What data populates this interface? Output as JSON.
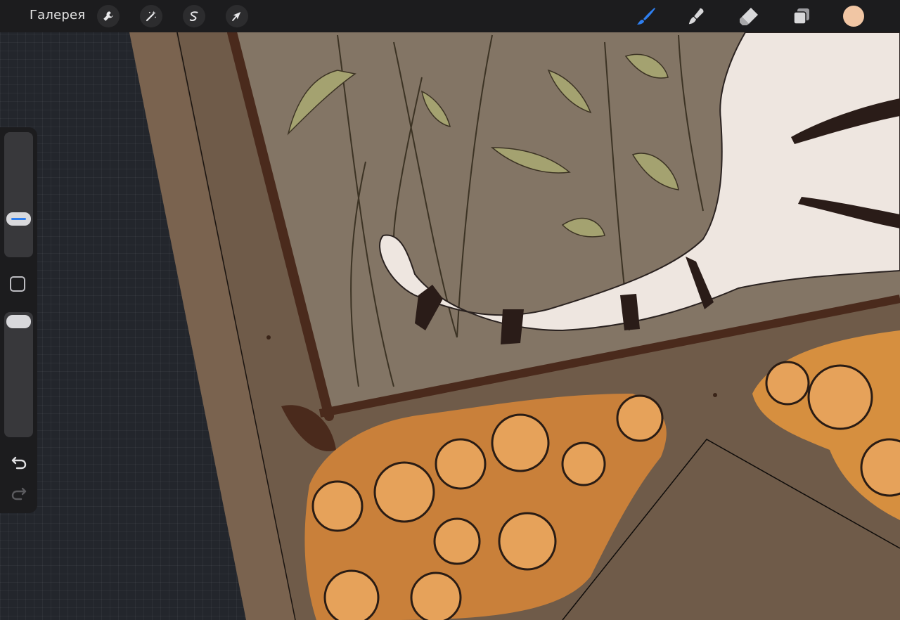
{
  "toolbar": {
    "gallery_label": "Галерея",
    "left_tools": [
      {
        "name": "actions",
        "icon": "wrench-icon"
      },
      {
        "name": "adjustments",
        "icon": "magic-wand-icon"
      },
      {
        "name": "selection",
        "icon": "selection-s-icon"
      },
      {
        "name": "transform",
        "icon": "arrow-cursor-icon"
      }
    ],
    "right_tools": [
      {
        "name": "brush",
        "icon": "brush-icon",
        "active": true
      },
      {
        "name": "smudge",
        "icon": "smudge-icon",
        "active": false
      },
      {
        "name": "eraser",
        "icon": "eraser-icon",
        "active": false
      },
      {
        "name": "layers",
        "icon": "layers-icon",
        "active": false
      }
    ],
    "current_color": "#f1c6a4",
    "active_tool_color": "#2e7ff0"
  },
  "sidebar": {
    "brush_size_level": 0.27,
    "opacity_level": 1.0,
    "slider_active_color": "#2e7ff0"
  }
}
